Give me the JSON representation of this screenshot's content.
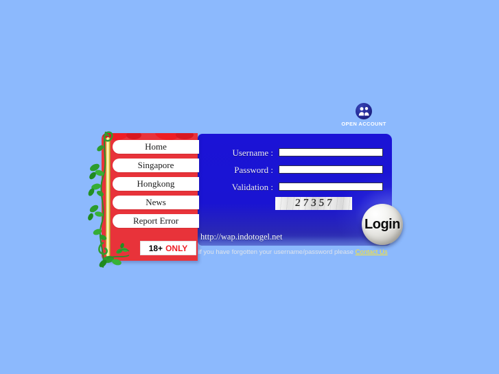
{
  "page": {
    "background_color": "#8cb9fd"
  },
  "open_account": {
    "label": "OPEN ACCOUNT",
    "icon": "two-people-icon",
    "icon_color": "#232a96"
  },
  "menu": {
    "panel_color": "#e8333a",
    "items": [
      {
        "label": "Home"
      },
      {
        "label": "Singapore"
      },
      {
        "label": "Hongkong"
      },
      {
        "label": "News"
      },
      {
        "label": "Report Error"
      }
    ],
    "age_badge": {
      "number": "18+",
      "word": "ONLY",
      "number_color": "#000000",
      "word_color": "#ee1d24"
    }
  },
  "login_form": {
    "panel_color": "#1a14d2",
    "fields": [
      {
        "label": "Username :",
        "value": "",
        "placeholder": ""
      },
      {
        "label": "Password :",
        "value": "",
        "placeholder": ""
      },
      {
        "label": "Validation :",
        "value": "",
        "placeholder": ""
      }
    ],
    "captcha_text": "27357",
    "site_url": "http://wap.indotogel.net",
    "login_button_label": "Login",
    "forgot_text": "if you have forgotten your username/password please",
    "contact_link_label": "Contact Us",
    "contact_link_color": "#ffe62e"
  }
}
